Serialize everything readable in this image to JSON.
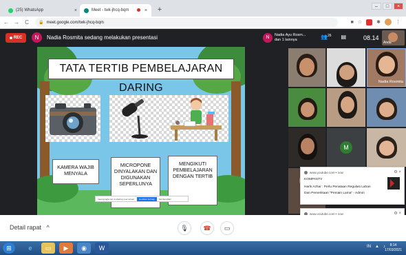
{
  "browser": {
    "tabs": [
      {
        "title": "(25) WhatsApp",
        "favicon_color": "#25d366"
      },
      {
        "title": "Meet - twk-jhcq-bqm",
        "favicon_color": "#00897b"
      }
    ],
    "new_tab_glyph": "+",
    "address": "meet.google.com/twk-jhcq-bqm",
    "window_controls": [
      "–",
      "□",
      "×"
    ]
  },
  "meet": {
    "rec_label": "REC",
    "presenter_initial": "N",
    "presenting_text": "Nadia Rosmita sedang melakukan presentasi",
    "viewer_initial": "N",
    "viewers_line1": "Nadia Ayu Rosm...",
    "viewers_line2": "dan 1 lainnya",
    "participant_count": "26",
    "clock": "08.14",
    "self_view_label": "Anda",
    "speaking_label": "Nadia Rosmita",
    "m_avatar_initial": "M",
    "details_label": "Detail rapat",
    "details_chevron": "^"
  },
  "slide": {
    "title": "TATA TERTIB PEMBELAJARAN DARING",
    "captions": [
      "KAMERA WAJIB MENYALA",
      "MICROPONE DINYALAKAN DAN DIGUNAKAN SEPERLUNYA",
      "MENGIKUTI PEMBELAJARAN DENGAN TERTIB"
    ],
    "share_bar_text": "meet.google.com is sharing your screen.",
    "share_bar_stop": "Hentikan berbagi",
    "share_bar_hide": "Sembunyikan"
  },
  "notifications": [
    {
      "source": "www.youtube.com • now",
      "line1": "KOMPASTV",
      "line2": "Harls Azhar : Perlu Penataan Regulasi Lahan",
      "line3": "Dan Pemerikaan \"Pemain Lama\" - Admin"
    },
    {
      "source": "www.youtube.com • now",
      "line1": "www.youtube.com",
      "line2": "This site has been updated in the background."
    }
  ],
  "taskbar": {
    "time": "8:14",
    "date": "17/03/2021"
  },
  "icons": {
    "back": "back-arrow-icon",
    "forward": "forward-arrow-icon",
    "reload": "reload-icon",
    "lock": "lock-icon",
    "mic": "microphone-icon",
    "end_call": "end-call-icon",
    "camera": "camera-icon"
  }
}
